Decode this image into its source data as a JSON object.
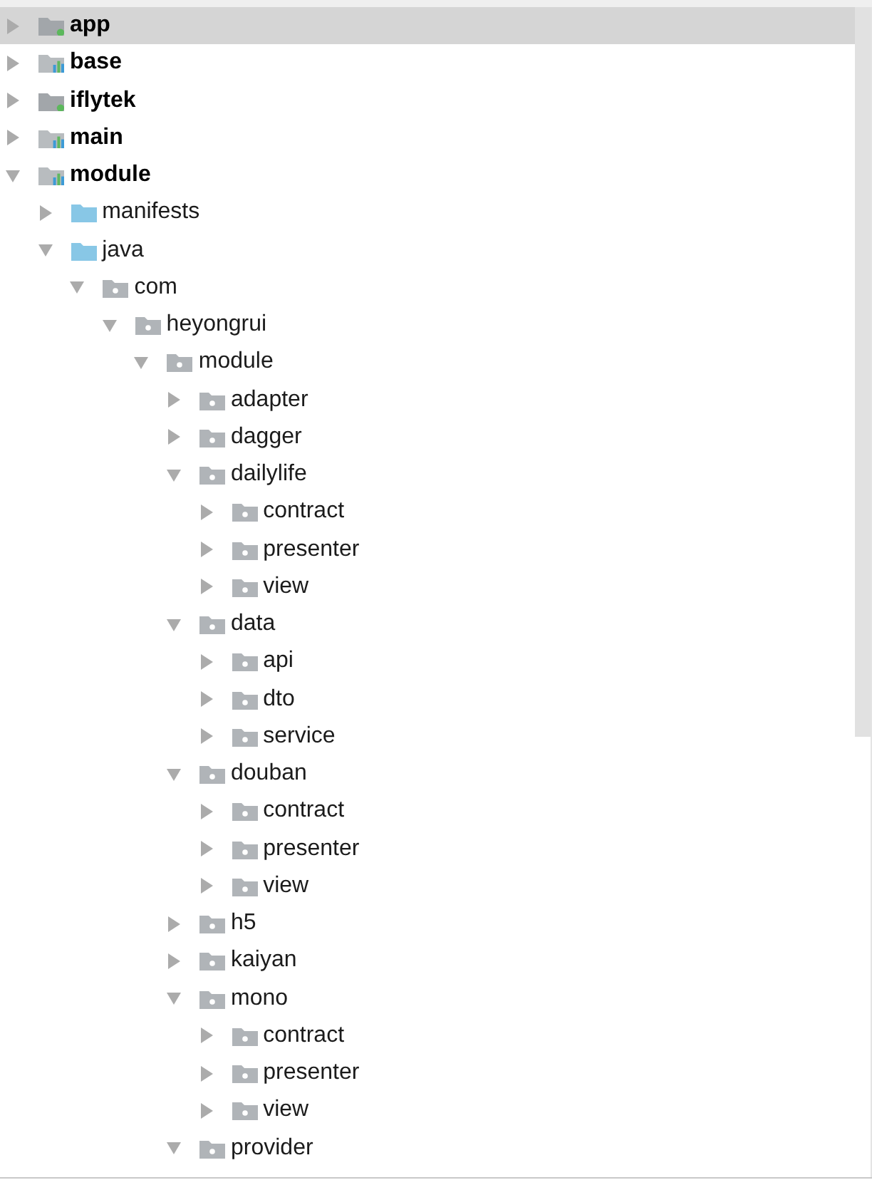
{
  "project_tree": {
    "items": [
      {
        "label": "app",
        "kind": "app-module",
        "expanded": false,
        "selected": true
      },
      {
        "label": "base",
        "kind": "library-module",
        "expanded": false,
        "selected": false
      },
      {
        "label": "iflytek",
        "kind": "app-module",
        "expanded": false,
        "selected": false
      },
      {
        "label": "main",
        "kind": "library-module",
        "expanded": false,
        "selected": false
      },
      {
        "label": "module",
        "kind": "library-module",
        "expanded": true,
        "selected": false,
        "children": [
          {
            "label": "manifests",
            "kind": "source-folder",
            "expanded": false,
            "selected": false
          },
          {
            "label": "java",
            "kind": "source-folder",
            "expanded": true,
            "selected": false,
            "children": [
              {
                "label": "com",
                "kind": "package",
                "expanded": true,
                "selected": false,
                "children": [
                  {
                    "label": "heyongrui",
                    "kind": "package",
                    "expanded": true,
                    "selected": false,
                    "children": [
                      {
                        "label": "module",
                        "kind": "package",
                        "expanded": true,
                        "selected": false,
                        "children": [
                          {
                            "label": "adapter",
                            "kind": "package",
                            "expanded": false,
                            "selected": false
                          },
                          {
                            "label": "dagger",
                            "kind": "package",
                            "expanded": false,
                            "selected": false
                          },
                          {
                            "label": "dailylife",
                            "kind": "package",
                            "expanded": true,
                            "selected": false,
                            "children": [
                              {
                                "label": "contract",
                                "kind": "package",
                                "expanded": false,
                                "selected": false
                              },
                              {
                                "label": "presenter",
                                "kind": "package",
                                "expanded": false,
                                "selected": false
                              },
                              {
                                "label": "view",
                                "kind": "package",
                                "expanded": false,
                                "selected": false
                              }
                            ]
                          },
                          {
                            "label": "data",
                            "kind": "package",
                            "expanded": true,
                            "selected": false,
                            "children": [
                              {
                                "label": "api",
                                "kind": "package",
                                "expanded": false,
                                "selected": false
                              },
                              {
                                "label": "dto",
                                "kind": "package",
                                "expanded": false,
                                "selected": false
                              },
                              {
                                "label": "service",
                                "kind": "package",
                                "expanded": false,
                                "selected": false
                              }
                            ]
                          },
                          {
                            "label": "douban",
                            "kind": "package",
                            "expanded": true,
                            "selected": false,
                            "children": [
                              {
                                "label": "contract",
                                "kind": "package",
                                "expanded": false,
                                "selected": false
                              },
                              {
                                "label": "presenter",
                                "kind": "package",
                                "expanded": false,
                                "selected": false
                              },
                              {
                                "label": "view",
                                "kind": "package",
                                "expanded": false,
                                "selected": false
                              }
                            ]
                          },
                          {
                            "label": "h5",
                            "kind": "package",
                            "expanded": false,
                            "selected": false
                          },
                          {
                            "label": "kaiyan",
                            "kind": "package",
                            "expanded": false,
                            "selected": false
                          },
                          {
                            "label": "mono",
                            "kind": "package",
                            "expanded": true,
                            "selected": false,
                            "children": [
                              {
                                "label": "contract",
                                "kind": "package",
                                "expanded": false,
                                "selected": false
                              },
                              {
                                "label": "presenter",
                                "kind": "package",
                                "expanded": false,
                                "selected": false
                              },
                              {
                                "label": "view",
                                "kind": "package",
                                "expanded": false,
                                "selected": false
                              }
                            ]
                          },
                          {
                            "label": "provider",
                            "kind": "package",
                            "expanded": true,
                            "selected": false
                          }
                        ]
                      }
                    ]
                  }
                ]
              }
            ]
          }
        ]
      }
    ]
  }
}
